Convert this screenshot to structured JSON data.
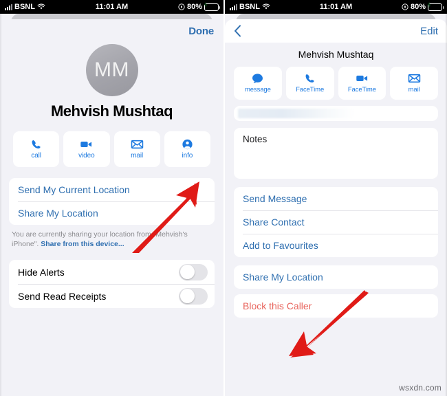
{
  "status_bar": {
    "carrier": "BSNL",
    "time": "11:01 AM",
    "battery_percent": "80%",
    "signal_icon": "signal-bars-icon",
    "wifi_icon": "wifi-icon",
    "location_icon": "location-services-icon",
    "battery_icon": "battery-charging-icon"
  },
  "left_screen": {
    "done_label": "Done",
    "avatar_initials": "MM",
    "contact_name": "Mehvish Mushtaq",
    "actions": [
      {
        "label": "call",
        "icon": "phone-icon"
      },
      {
        "label": "video",
        "icon": "video-camera-icon"
      },
      {
        "label": "mail",
        "icon": "envelope-icon"
      },
      {
        "label": "info",
        "icon": "person-circle-icon"
      }
    ],
    "location_rows": [
      "Send My Current Location",
      "Share My Location"
    ],
    "location_hint_prefix": "You are currently sharing your location from \"Mehvish's iPhone\". ",
    "location_hint_link": "Share from this device...",
    "toggles": [
      {
        "label": "Hide Alerts",
        "on": false
      },
      {
        "label": "Send Read Receipts",
        "on": false
      }
    ]
  },
  "right_screen": {
    "back_icon": "chevron-left-icon",
    "edit_label": "Edit",
    "contact_name": "Mehvish Mushtaq",
    "actions": [
      {
        "label": "message",
        "icon": "message-bubble-icon"
      },
      {
        "label": "FaceTime",
        "icon": "phone-icon"
      },
      {
        "label": "FaceTime",
        "icon": "video-camera-icon"
      },
      {
        "label": "mail",
        "icon": "envelope-icon"
      }
    ],
    "notes_label": "Notes",
    "action_rows": [
      "Send Message",
      "Share Contact",
      "Add to Favourites"
    ],
    "share_location_label": "Share My Location",
    "block_label": "Block this Caller"
  },
  "annotations": {
    "arrow_color": "#e01b17",
    "left_arrow_target": "info",
    "right_arrow_target": "Block this Caller"
  },
  "watermark": "wsxdn.com",
  "colors": {
    "accent_blue": "#2f6fb0",
    "button_blue": "#1d7ae0",
    "destructive_red": "#e8645c",
    "background": "#f2f2f7",
    "card": "#ffffff"
  }
}
